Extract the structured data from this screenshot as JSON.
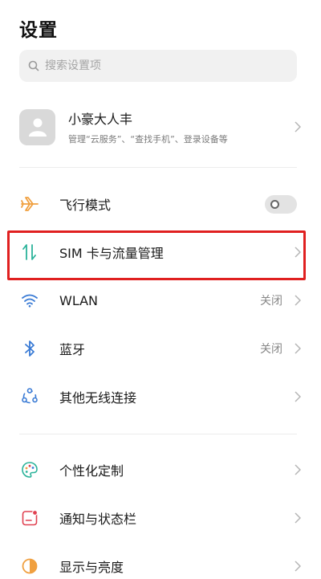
{
  "header": {
    "title": "设置"
  },
  "search": {
    "placeholder": "搜索设置项",
    "icon": "search-icon"
  },
  "profile": {
    "name": "小豪大人丰",
    "description": "管理“云服务”、“查找手机”、登录设备等"
  },
  "settings_group_1": [
    {
      "id": "airplane",
      "label": "飞行模式",
      "icon": "airplane-icon",
      "icon_color": "#f0a040",
      "control": "toggle",
      "toggle_on": false
    },
    {
      "id": "sim",
      "label": "SIM 卡与流量管理",
      "icon": "data-transfer-icon",
      "icon_color": "#2bb39a",
      "control": "chevron",
      "highlighted": true
    },
    {
      "id": "wlan",
      "label": "WLAN",
      "value": "关闭",
      "icon": "wifi-icon",
      "icon_color": "#3a7bd5",
      "control": "chevron"
    },
    {
      "id": "bluetooth",
      "label": "蓝牙",
      "value": "关闭",
      "icon": "bluetooth-icon",
      "icon_color": "#3a7bd5",
      "control": "chevron"
    },
    {
      "id": "wireless",
      "label": "其他无线连接",
      "icon": "wireless-connections-icon",
      "icon_color": "#3a7bd5",
      "control": "chevron"
    }
  ],
  "settings_group_2": [
    {
      "id": "personalize",
      "label": "个性化定制",
      "icon": "palette-icon",
      "icon_color": "#2bb39a",
      "control": "chevron"
    },
    {
      "id": "notifications",
      "label": "通知与状态栏",
      "icon": "notification-icon",
      "icon_color": "#e04050",
      "control": "chevron"
    },
    {
      "id": "display",
      "label": "显示与亮度",
      "icon": "brightness-icon",
      "icon_color": "#f0a040",
      "control": "chevron"
    }
  ],
  "highlight_color": "#e02020"
}
